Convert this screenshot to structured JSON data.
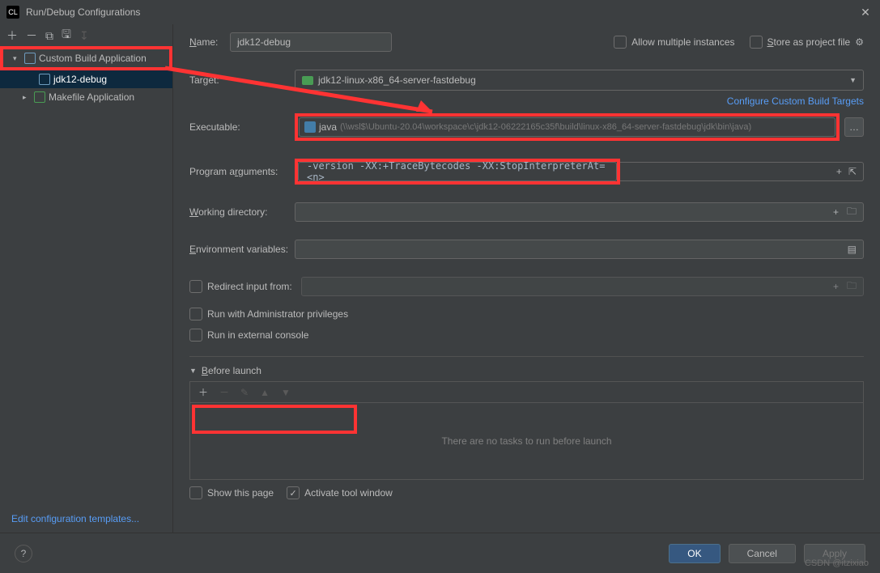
{
  "window": {
    "title": "Run/Debug Configurations"
  },
  "sidebar": {
    "custom_build_label": "Custom Build Application",
    "jdk_item": "jdk12-debug",
    "makefile_label": "Makefile Application",
    "edit_templates": "Edit configuration templates..."
  },
  "form": {
    "name_label": "Name:",
    "name_value": "jdk12-debug",
    "allow_multiple": "Allow multiple instances",
    "store_as_project": "Store as project file",
    "target_label": "Target:",
    "target_value": "jdk12-linux-x86_64-server-fastdebug",
    "configure_targets": "Configure Custom Build Targets",
    "executable_label": "Executable:",
    "executable_name": "java",
    "executable_path": "(\\\\wsl$\\Ubuntu-20.04\\workspace\\c\\jdk12-06222165c35f\\build\\linux-x86_64-server-fastdebug\\jdk\\bin\\java)",
    "args_label": "Program arguments:",
    "args_value": "-version -XX:+TraceBytecodes -XX:StopInterpreterAt=<n>",
    "workdir_label": "Working directory:",
    "envvars_label": "Environment variables:",
    "redirect_label": "Redirect input from:",
    "admin_label": "Run with Administrator privileges",
    "external_label": "Run in external console"
  },
  "before": {
    "header": "Before launch",
    "empty": "There are no tasks to run before launch",
    "show_page": "Show this page",
    "activate_tool": "Activate tool window"
  },
  "buttons": {
    "ok": "OK",
    "cancel": "Cancel",
    "apply": "Apply"
  },
  "watermark": "CSDN @itzixiao"
}
